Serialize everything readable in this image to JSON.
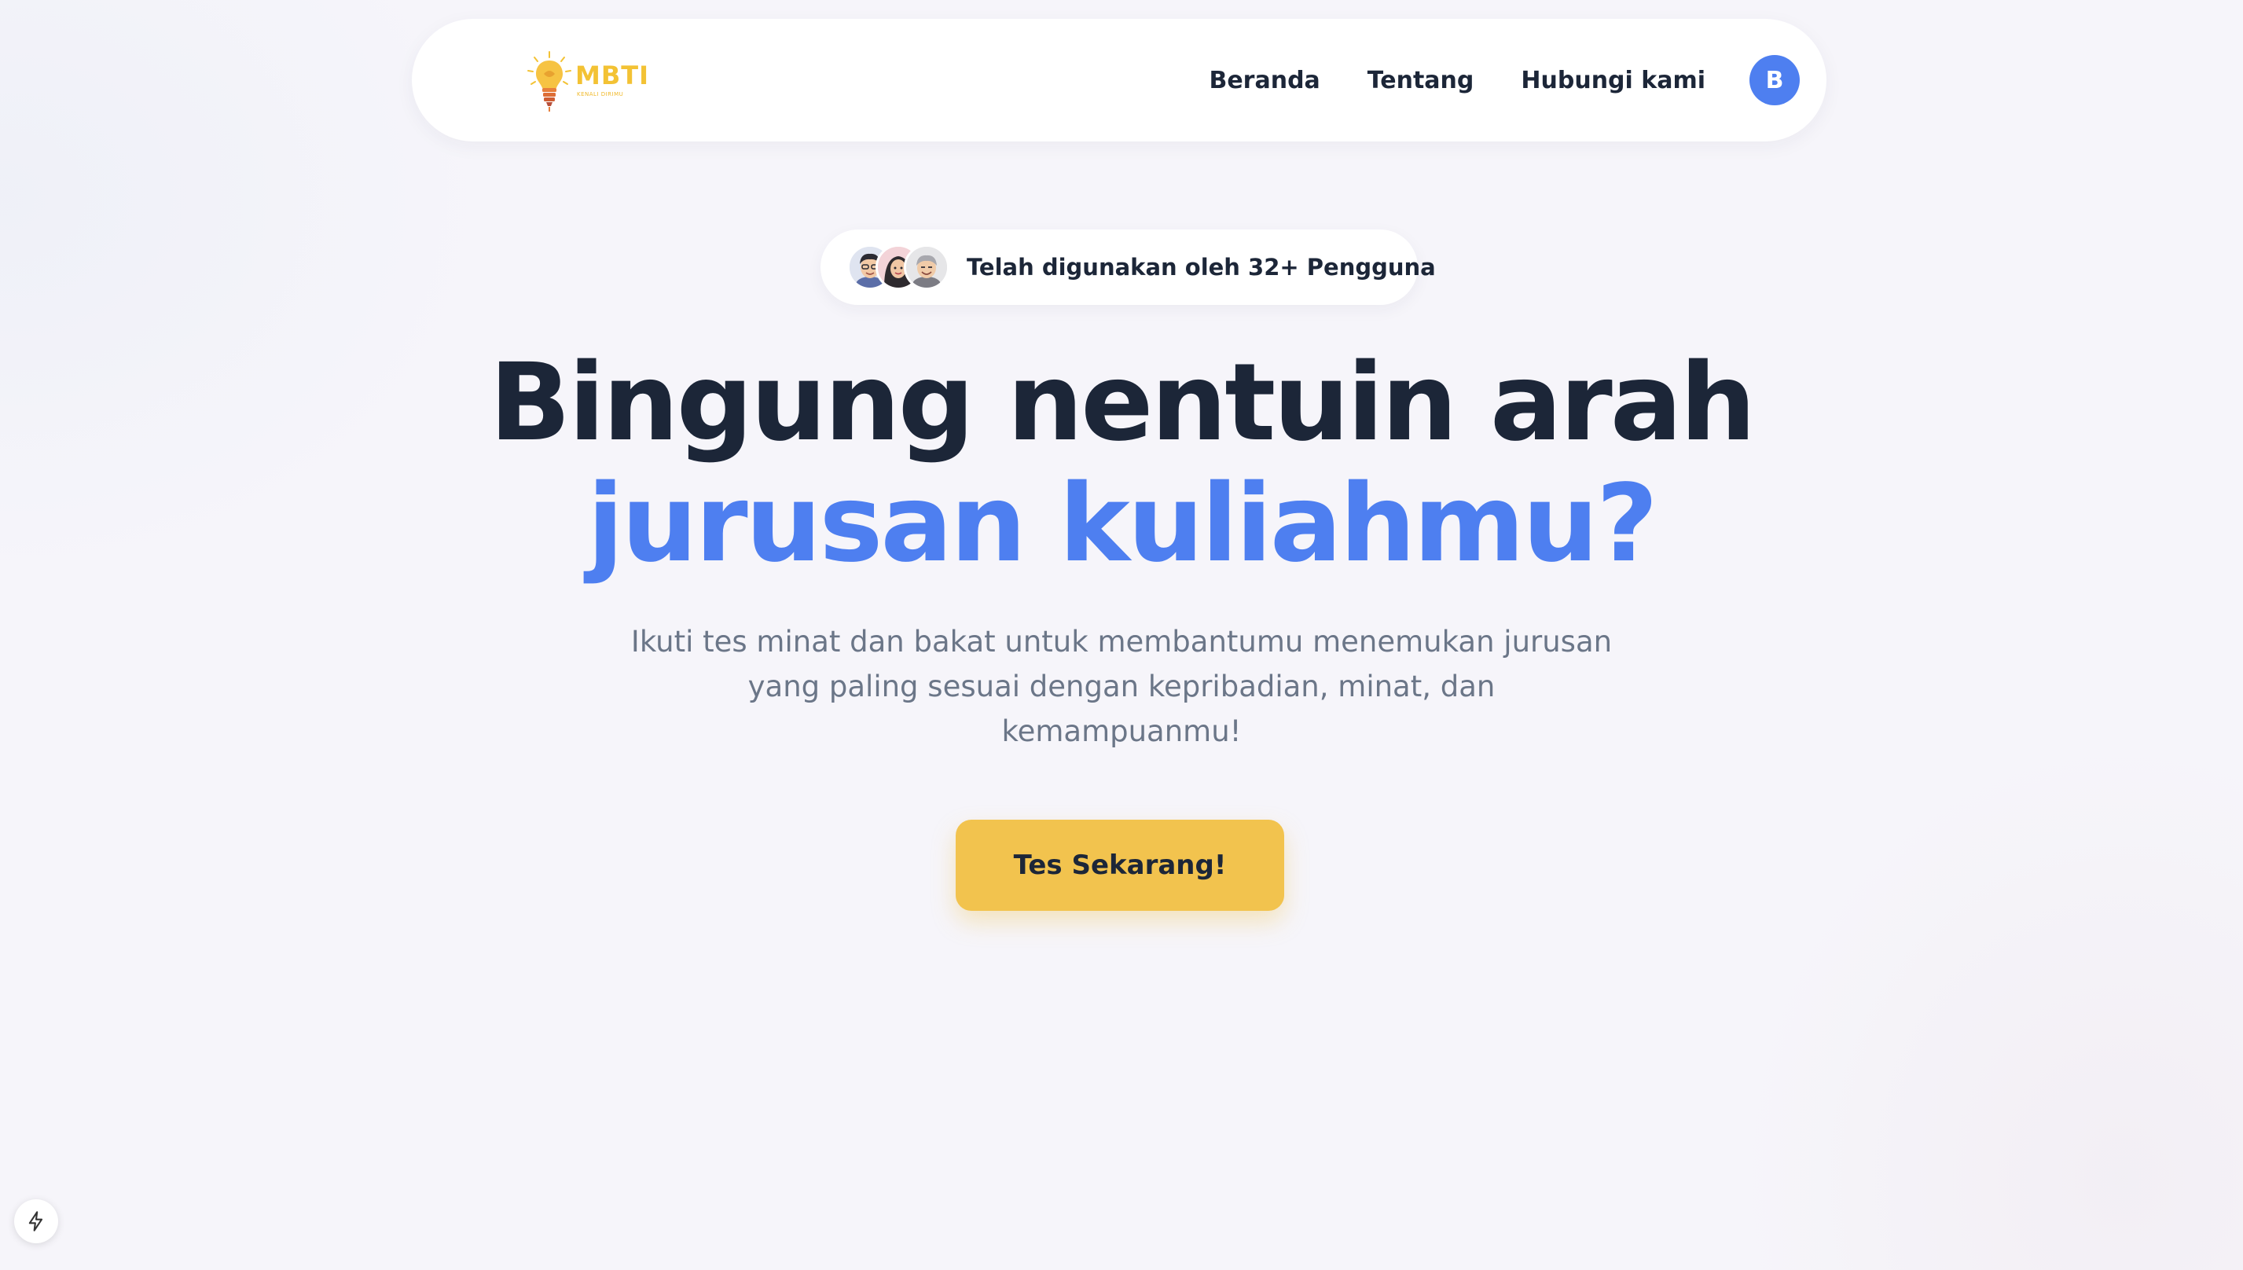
{
  "brand": {
    "logo_text": "MBTI",
    "logo_subtext": "KENALI DIRIMU",
    "logo_icon": "lightbulb-icon",
    "accent_color": "#f3c234"
  },
  "nav": {
    "items": [
      {
        "label": "Beranda"
      },
      {
        "label": "Tentang"
      },
      {
        "label": "Hubungi kami"
      }
    ],
    "avatar_initial": "B",
    "avatar_color": "#4e7ff0"
  },
  "badge": {
    "text": "Telah digunakan oleh 32+ Pengguna",
    "avatars": [
      "user-avatar-1",
      "user-avatar-2",
      "user-avatar-3"
    ]
  },
  "hero": {
    "title_line1": "Bingung nentuin arah",
    "title_line2": "jurusan kuliahmu?",
    "title_color": "#1c2638",
    "highlight_color": "#4e7ff0",
    "description": "Ikuti tes minat dan bakat untuk membantumu menemukan jurusan yang paling sesuai dengan kepribadian, minat, dan kemampuanmu!"
  },
  "cta": {
    "label": "Tes Sekarang!",
    "color": "#f2c34e"
  },
  "dev_indicator": {
    "icon": "lightning-icon"
  }
}
